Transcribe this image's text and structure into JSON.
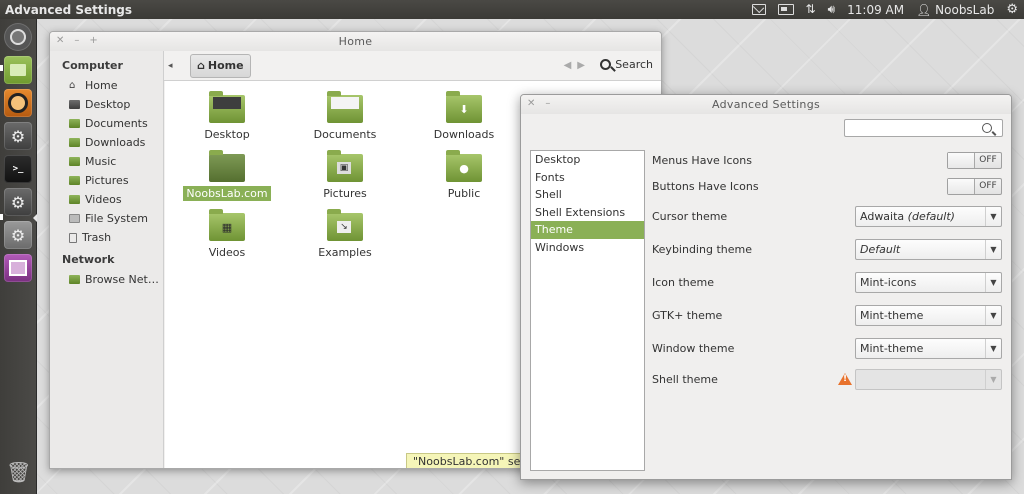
{
  "top_panel": {
    "app_title": "Advanced Settings",
    "clock": "11:09 AM",
    "user": "NoobsLab",
    "icons": [
      "mail-icon",
      "battery-icon",
      "network-icon",
      "sound-icon",
      "user-icon",
      "gear-icon"
    ]
  },
  "launcher": {
    "items": [
      "dash-icon",
      "files-icon",
      "software-center-icon",
      "settings-icon",
      "terminal-icon",
      "settings-icon",
      "settings-icon",
      "workspace-switcher-icon"
    ],
    "trash": "trash-icon"
  },
  "nautilus": {
    "title": "Home",
    "location": "Home",
    "search_label": "Search",
    "sidebar": {
      "computer_header": "Computer",
      "computer_items": [
        "Home",
        "Desktop",
        "Documents",
        "Downloads",
        "Music",
        "Pictures",
        "Videos",
        "File System",
        "Trash"
      ],
      "network_header": "Network",
      "network_items": [
        "Browse Net…"
      ]
    },
    "files": [
      {
        "name": "Desktop",
        "kind": "desktop"
      },
      {
        "name": "Documents",
        "kind": "documents"
      },
      {
        "name": "Downloads",
        "kind": "downloads"
      },
      {
        "name": "NoobsLab.com",
        "kind": "folder",
        "selected": true
      },
      {
        "name": "Pictures",
        "kind": "pictures"
      },
      {
        "name": "Public",
        "kind": "public"
      },
      {
        "name": "Videos",
        "kind": "videos"
      },
      {
        "name": "Examples",
        "kind": "examples"
      }
    ],
    "status": "\"NoobsLab.com\" sel"
  },
  "advanced_settings": {
    "title": "Advanced Settings",
    "search_placeholder": "",
    "categories": [
      "Desktop",
      "Fonts",
      "Shell",
      "Shell Extensions",
      "Theme",
      "Windows"
    ],
    "active_category": "Theme",
    "rows": [
      {
        "label": "Menus Have Icons",
        "control": "switch",
        "value": "OFF"
      },
      {
        "label": "Buttons Have Icons",
        "control": "switch",
        "value": "OFF"
      },
      {
        "label": "Cursor theme",
        "control": "combo",
        "value": "Adwaita",
        "suffix": "(default)"
      },
      {
        "label": "Keybinding theme",
        "control": "combo",
        "value": "Default",
        "italic": true
      },
      {
        "label": "Icon theme",
        "control": "combo",
        "value": "Mint-icons"
      },
      {
        "label": "GTK+ theme",
        "control": "combo",
        "value": "Mint-theme"
      },
      {
        "label": "Window theme",
        "control": "combo",
        "value": "Mint-theme"
      },
      {
        "label": "Shell theme",
        "control": "combo",
        "value": "",
        "disabled": true,
        "warning": true
      }
    ]
  },
  "colors": {
    "accent_green": "#8ab056",
    "panel_dark": "#3b3a36",
    "warning_orange": "#e8722c"
  }
}
